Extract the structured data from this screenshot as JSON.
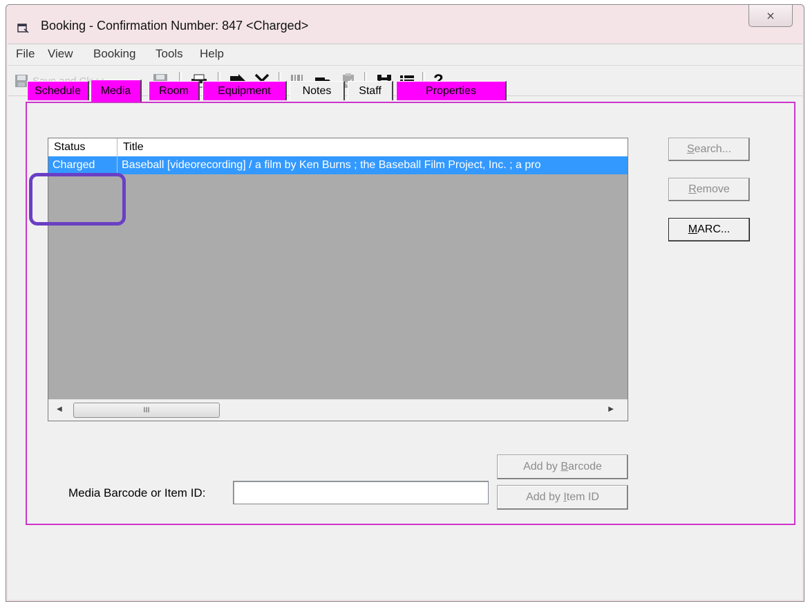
{
  "window": {
    "title": "Booking - Confirmation Number:  847  <Charged>",
    "close_glyph": "⨯"
  },
  "menu": [
    "File",
    "View",
    "Booking",
    "Tools",
    "Help"
  ],
  "toolbar": {
    "save_and_close_label": "Save and Close",
    "help_glyph": "?"
  },
  "tabs": [
    {
      "label": "Schedule",
      "color": "#ff00ff"
    },
    {
      "label": "Media",
      "color": "#ff00ff",
      "active": true
    },
    {
      "label": "Room",
      "color": "#ff00ff"
    },
    {
      "label": "Equipment",
      "color": "#ff00ff"
    },
    {
      "label": "Notes",
      "color": "#f0f0f0"
    },
    {
      "label": "Staff",
      "color": "#f0f0f0"
    },
    {
      "label": "Properties",
      "color": "#ff00ff"
    }
  ],
  "media_list": {
    "columns": [
      "Status",
      "Title"
    ],
    "rows": [
      {
        "status": "Charged",
        "title": "Baseball [videorecording] / a film by Ken Burns ; the Baseball Film Project, Inc. ; a pro"
      }
    ],
    "scroll_thumb_glyph": "III"
  },
  "side_buttons": {
    "search": {
      "pre": "",
      "mn": "S",
      "post": "earch..."
    },
    "remove": {
      "pre": "",
      "mn": "R",
      "post": "emove"
    },
    "marc": {
      "pre": "",
      "mn": "M",
      "post": "ARC..."
    }
  },
  "barcode": {
    "label": "Media Barcode or Item ID:",
    "value": "",
    "add_by_barcode": {
      "pre": "Add by ",
      "mn": "B",
      "post": "arcode"
    },
    "add_by_item_id": {
      "pre": "Add by ",
      "mn": "I",
      "post": "tem ID"
    }
  },
  "colors": {
    "tab_accent": "#ff00ff",
    "panel_border": "#cc33cc",
    "selection": "#3399ff",
    "annotation": "#6a3fc4"
  }
}
